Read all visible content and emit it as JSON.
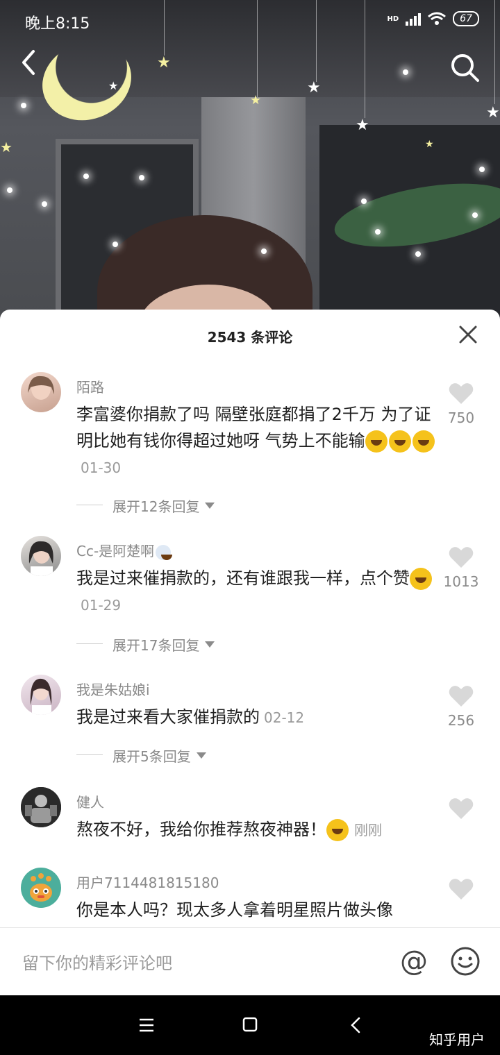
{
  "status_bar": {
    "time": "晚上8:15",
    "network": "HD",
    "battery": "67"
  },
  "sheet": {
    "title": "2543 条评论"
  },
  "comments": [
    {
      "username": "陌路",
      "text": "李富婆你捐款了吗 隔壁张庭都捐了2千万 为了证明比她有钱你得超过她呀 气势上不能输",
      "emojis": [
        "rofl-emoji",
        "rofl-emoji",
        "rofl-emoji"
      ],
      "time": "01-30",
      "likes": "750",
      "replies": "展开12条回复"
    },
    {
      "username": "Cc-是阿楚啊",
      "text": "我是过来催捐款的，还有谁跟我一样，点个赞",
      "emojis": [
        "thinking-emoji"
      ],
      "time": "01-29",
      "likes": "1013",
      "replies": "展开17条回复"
    },
    {
      "username": "我是朱姑娘i",
      "text": "我是过来看大家催捐款的",
      "emojis": [],
      "time": "02-12",
      "likes": "256",
      "replies": "展开5条回复"
    },
    {
      "username": "健人",
      "text": "熬夜不好，我给你推荐熬夜神器！",
      "emojis": [
        "grin-emoji"
      ],
      "time": "刚刚",
      "likes": "",
      "replies": ""
    },
    {
      "username": "用户7114481815180",
      "text": "你是本人吗？现太多人拿着明星照片做头像",
      "emojis": [],
      "time": "",
      "likes": "",
      "replies": ""
    }
  ],
  "input": {
    "placeholder": "留下你的精彩评论吧",
    "at_symbol": "@"
  },
  "watermark": "知乎用户",
  "colors": {
    "sheet_bg": "#ffffff",
    "text_primary": "#1f1f1f",
    "text_secondary": "#8a8a8a",
    "like_icon": "#d8d8d8",
    "nav_bg": "#000000"
  }
}
